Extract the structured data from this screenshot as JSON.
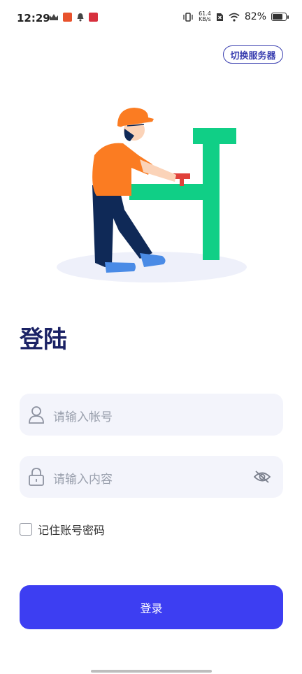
{
  "status_bar": {
    "time": "12:29",
    "net_speed_value": "61.4",
    "net_speed_unit": "KB/s",
    "battery": "82%",
    "battery_level": 0.82,
    "icons": [
      "crown-icon",
      "app-badge-icon",
      "bell-icon",
      "app-badge-icon",
      "vibrate-icon",
      "wifi-icon",
      "battery-icon"
    ]
  },
  "header": {
    "switch_server_label": "切换服务器"
  },
  "login": {
    "title": "登陆",
    "account_placeholder": "请输入帐号",
    "password_placeholder": "请输入内容",
    "remember_label": "记住账号密码",
    "submit_label": "登录"
  },
  "colors": {
    "primary": "#3d3ef2",
    "title": "#1b2265",
    "field_bg": "#f3f4fb",
    "accent_green": "#10cf86",
    "accent_orange": "#fb7c22"
  }
}
